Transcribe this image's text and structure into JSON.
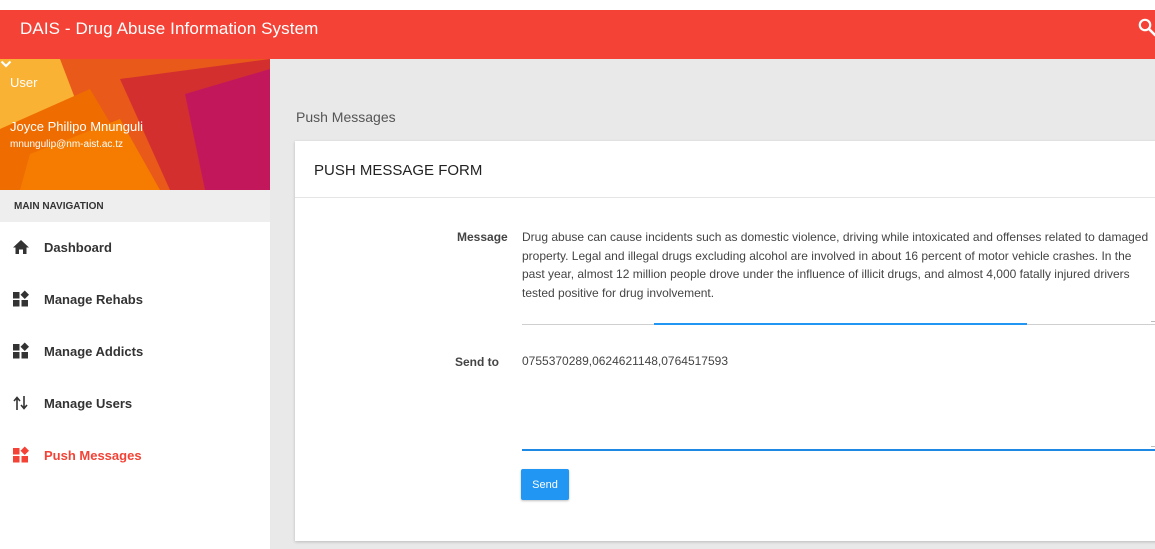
{
  "app": {
    "title": "DAIS - Drug Abuse Information System"
  },
  "colors": {
    "brand": "#f44336",
    "accent": "#2196f3"
  },
  "icons": {
    "search": "search-icon",
    "menu_toggle": "chevron-down-icon"
  },
  "user": {
    "label": "User",
    "name": "Joyce Philipo Mnunguli",
    "email": "mnungulip@nm-aist.ac.tz"
  },
  "nav": {
    "header": "MAIN NAVIGATION",
    "items": [
      {
        "label": "Dashboard",
        "icon": "home-icon",
        "active": false
      },
      {
        "label": "Manage Rehabs",
        "icon": "widgets-icon",
        "active": false
      },
      {
        "label": "Manage Addicts",
        "icon": "widgets-icon",
        "active": false
      },
      {
        "label": "Manage Users",
        "icon": "swap-icon",
        "active": false
      },
      {
        "label": "Push Messages",
        "icon": "widgets-icon",
        "active": true
      }
    ]
  },
  "main": {
    "page_title": "Push Messages",
    "form": {
      "title": "PUSH MESSAGE FORM",
      "message_label": "Message",
      "message_value": "Drug abuse can cause incidents such as domestic violence, driving while intoxicated and offenses related to damaged property. Legal and illegal drugs excluding alcohol are involved in about 16 percent of motor vehicle crashes. In the past year, almost 12 million people drove under the influence of illicit drugs, and almost 4,000 fatally injured drivers tested positive for drug involvement.",
      "sendto_label": "Send to",
      "sendto_value": "0755370289,0624621148,0764517593",
      "send_button": "Send"
    }
  }
}
